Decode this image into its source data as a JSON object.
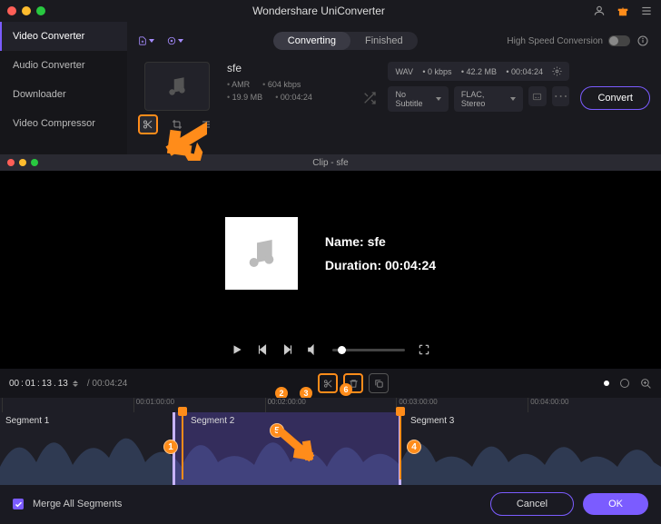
{
  "titlebar": {
    "title": "Wondershare UniConverter"
  },
  "sidebar": {
    "items": [
      {
        "label": "Video Converter"
      },
      {
        "label": "Audio Converter"
      },
      {
        "label": "Downloader"
      },
      {
        "label": "Video Compressor"
      }
    ]
  },
  "tabs": {
    "converting": "Converting",
    "finished": "Finished"
  },
  "toolbar": {
    "hs_label": "High Speed Conversion"
  },
  "file": {
    "name": "sfe",
    "codec": "AMR",
    "bitrate_in": "604 kbps",
    "size": "19.9 MB",
    "dur": "00:04:24",
    "out_fmt": "WAV",
    "out_br": "0 kbps",
    "out_size": "42.2 MB",
    "out_dur": "00:04:24",
    "sub": "No Subtitle",
    "audio": "FLAC, Stereo",
    "convert": "Convert"
  },
  "clip": {
    "header": "Clip - sfe",
    "name_label": "Name: sfe",
    "dur_label": "Duration: 00:04:24"
  },
  "tc": {
    "h": "00",
    "m": "01",
    "s": "13",
    "f": "13",
    "total": "/ 00:04:24",
    "badge2": "2",
    "badge3": "3",
    "badge6": "6"
  },
  "timeline": {
    "ticks": [
      "",
      "00:01:00:00",
      "00:02:00:00",
      "00:03:00:00",
      "00:04:00:00"
    ],
    "seg1": "Segment 1",
    "seg2": "Segment 2",
    "seg3": "Segment 3",
    "b1": "1",
    "b4": "4",
    "b5": "5"
  },
  "footer": {
    "merge": "Merge All Segments",
    "cancel": "Cancel",
    "ok": "OK"
  }
}
